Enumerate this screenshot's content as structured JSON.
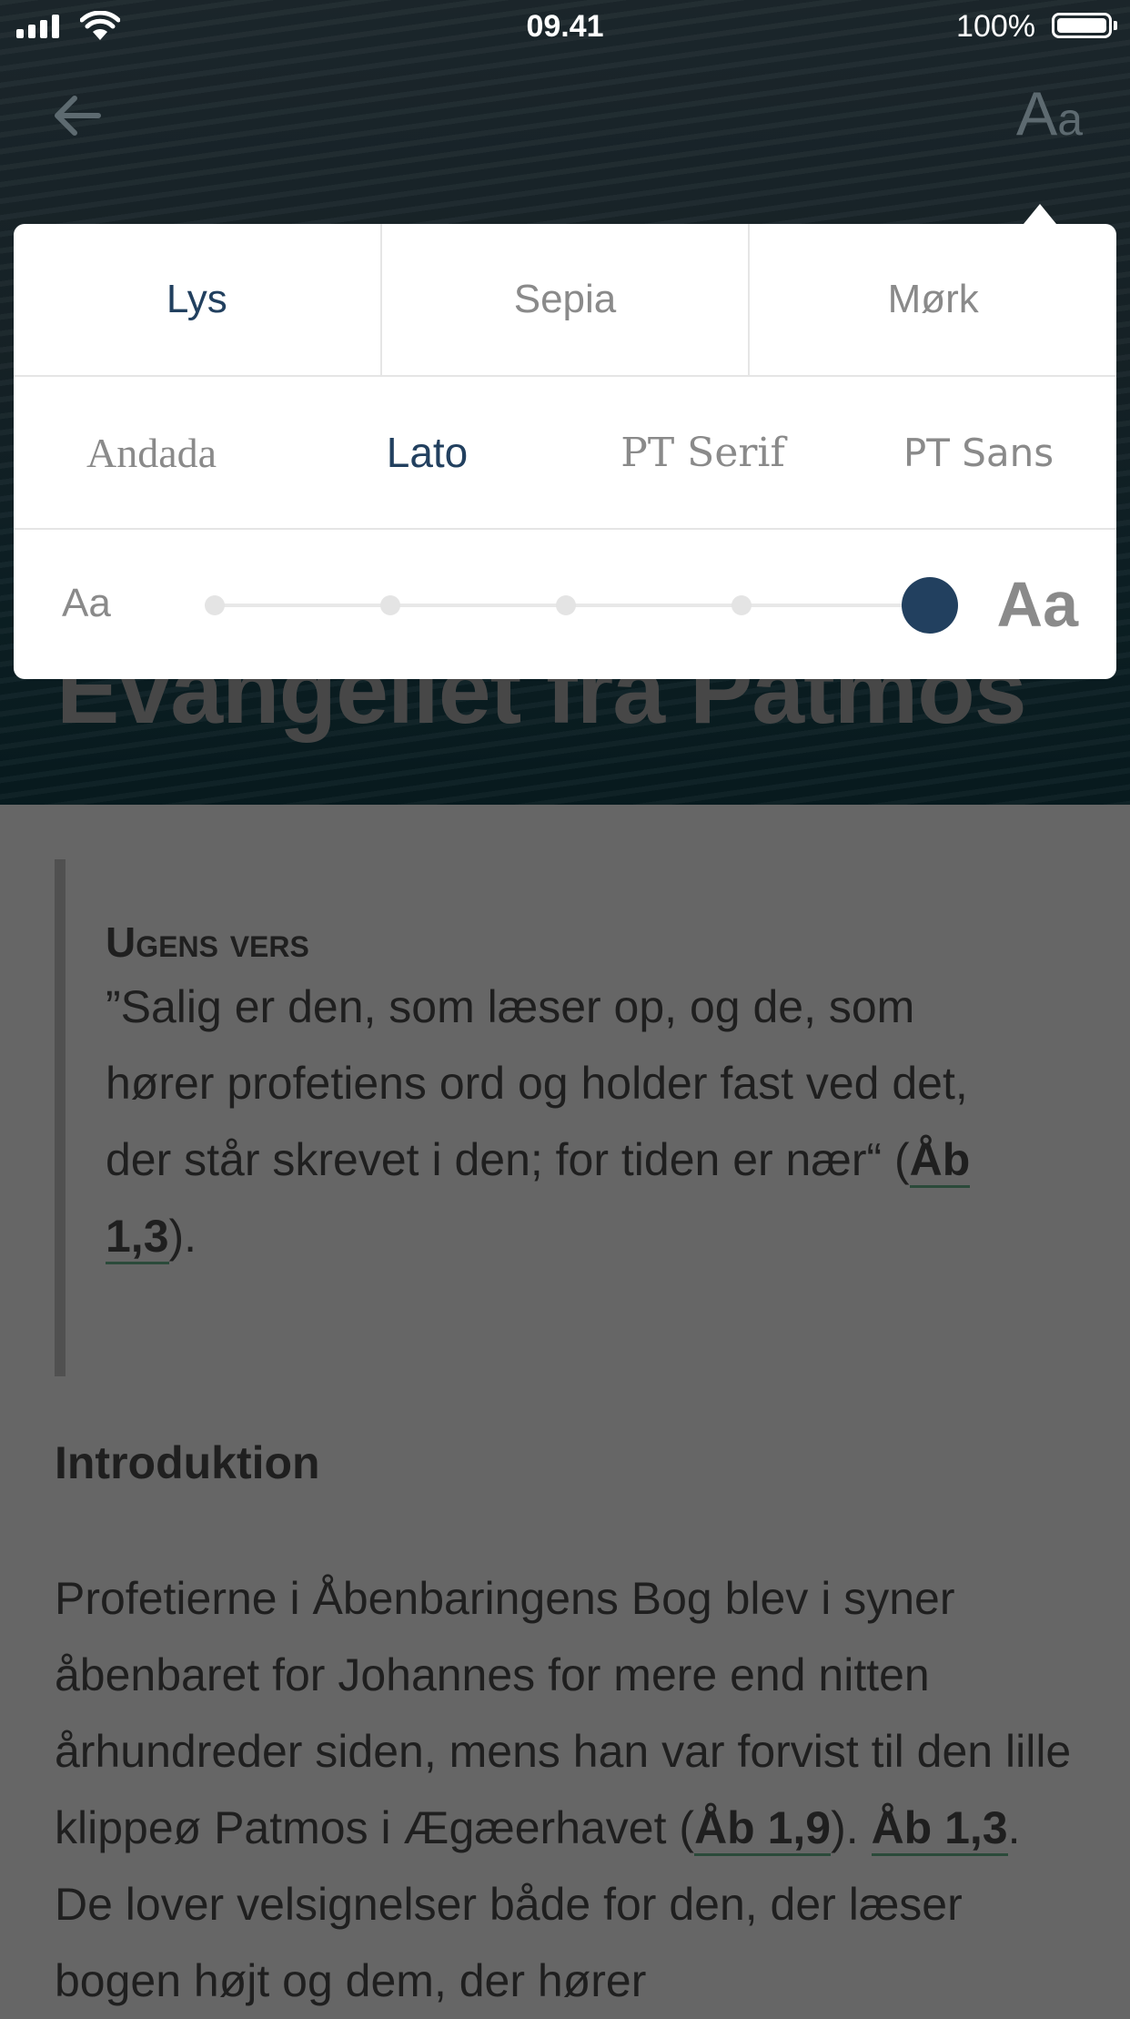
{
  "status_bar": {
    "time": "09.41",
    "battery": "100%"
  },
  "header": {
    "back_icon": "arrow-left-icon",
    "font_settings_label_big": "A",
    "font_settings_label_small": "a"
  },
  "hero": {
    "title": "Evangeliet fra Patmos"
  },
  "settings_panel": {
    "themes": [
      {
        "label": "Lys",
        "active": true
      },
      {
        "label": "Sepia",
        "active": false
      },
      {
        "label": "Mørk",
        "active": false
      }
    ],
    "fonts": [
      {
        "label": "Andada",
        "active": false
      },
      {
        "label": "Lato",
        "active": true
      },
      {
        "label": "PT Serif",
        "active": false
      },
      {
        "label": "PT Sans",
        "active": false
      }
    ],
    "size": {
      "small_label": "Aa",
      "large_label": "Aa",
      "steps": 5,
      "selected_step": 5
    },
    "accent_color": "#22405f"
  },
  "quote": {
    "heading": "Ugens vers",
    "text": "”Salig er den, som læser op, og de, som hører profetiens ord og holder fast ved det, der står skrevet i den; for tiden er nær“ (",
    "reference": "Åb 1,3",
    "text_end": ")."
  },
  "section": {
    "title": "Introduktion"
  },
  "intro": {
    "text_1": "Profetierne i Åbenbaringens Bog blev i syner åbenbaret for Johannes for mere end nitten århundreder siden, mens han var forvist til den lille klippeø Patmos i Ægæerhavet (",
    "ref_1": "Åb 1,9",
    "text_2": "). ",
    "ref_2": "Åb 1,3",
    "text_3": ". De lover velsignelser både for den, der læser bogen højt og dem, der hører"
  }
}
